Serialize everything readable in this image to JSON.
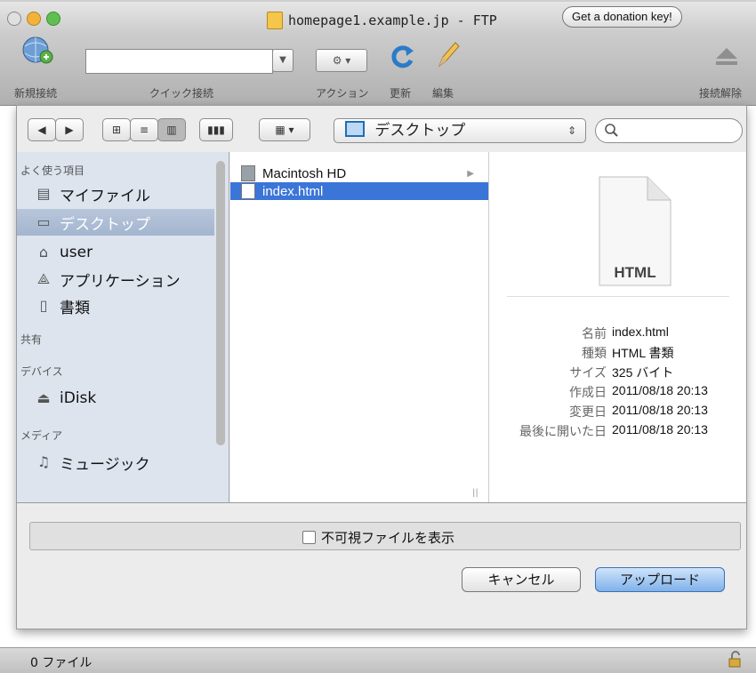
{
  "window": {
    "title": "homepage1.example.jp - FTP",
    "donation_button": "Get a donation key!"
  },
  "toolbar": {
    "new_connection": "新規接続",
    "quick_connect": "クイック接続",
    "action": "アクション",
    "refresh": "更新",
    "edit": "編集",
    "disconnect": "接続解除",
    "action_icon": "gear-icon",
    "quick_input_value": ""
  },
  "sheet": {
    "location": "デスクトップ",
    "search_value": "",
    "sidebar": {
      "sections": [
        {
          "header": "よく使う項目"
        },
        {
          "header": "共有"
        },
        {
          "header": "デバイス"
        },
        {
          "header": "メディア"
        }
      ],
      "items": [
        {
          "label": "マイファイル",
          "icon": "my-files-icon"
        },
        {
          "label": "デスクトップ",
          "icon": "desktop-icon",
          "selected": true
        },
        {
          "label": "user",
          "icon": "home-icon"
        },
        {
          "label": "アプリケーション",
          "icon": "applications-icon"
        },
        {
          "label": "書類",
          "icon": "documents-icon"
        },
        {
          "label": "iDisk",
          "icon": "idisk-icon"
        },
        {
          "label": "ミュージック",
          "icon": "music-icon"
        }
      ]
    },
    "files": [
      {
        "name": "Macintosh HD",
        "icon": "hard-drive-icon",
        "has_children": true
      },
      {
        "name": "index.html",
        "icon": "html-file-icon",
        "selected": true
      }
    ],
    "preview": {
      "doc_label": "HTML",
      "info": [
        {
          "label": "名前",
          "value": "index.html"
        },
        {
          "label": "種類",
          "value": "HTML 書類"
        },
        {
          "label": "サイズ",
          "value": "325 バイト"
        },
        {
          "label": "作成日",
          "value": "2011/08/18 20:13"
        },
        {
          "label": "変更日",
          "value": "2011/08/18 20:13"
        },
        {
          "label": "最後に開いた日",
          "value": "2011/08/18 20:13"
        }
      ]
    },
    "show_hidden_label": "不可視ファイルを表示",
    "show_hidden_checked": false,
    "cancel_label": "キャンセル",
    "upload_label": "アップロード"
  },
  "status": {
    "file_count": "0 ファイル"
  },
  "colors": {
    "selection": "#3b75d8",
    "sidebar_bg": "#dde4ee"
  }
}
